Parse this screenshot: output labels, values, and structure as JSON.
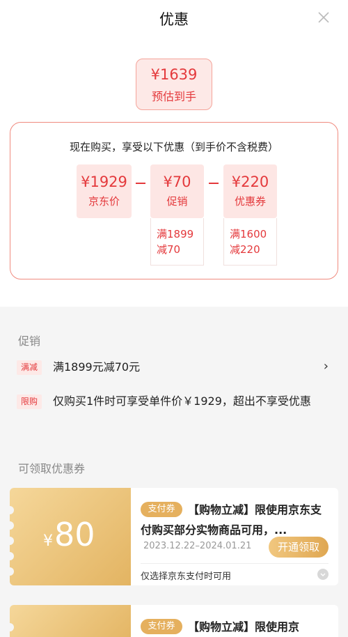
{
  "header": {
    "title": "优惠",
    "close_icon": "close-icon"
  },
  "summary": {
    "final_price": "¥1639",
    "final_label": "预估到手"
  },
  "calculation": {
    "note": "现在购买，享受以下优惠（到手价不含税费）",
    "items": [
      {
        "value": "¥1929",
        "label": "京东价"
      },
      {
        "value": "¥70",
        "label": "促销",
        "condition_line1": "满1899",
        "condition_line2": "减70"
      },
      {
        "value": "¥220",
        "label": "优惠券",
        "condition_line1": "满1600",
        "condition_line2": "减220"
      }
    ],
    "operator": "−"
  },
  "promotions": {
    "title": "促销",
    "items": [
      {
        "tag": "满减",
        "text": "满1899元减70元",
        "chevron": "›"
      },
      {
        "tag": "限购",
        "text": "仅购买1件时可享受单件价￥1929，超出不享受优惠"
      }
    ]
  },
  "coupons": {
    "title": "可领取优惠券",
    "items": [
      {
        "currency": "¥",
        "amount": "80",
        "type_tag": "支付券",
        "description": "【购物立减】限使用京东支付购买部分实物商品可用，...",
        "date": "2023.12.22–2024.01.21",
        "button": "开通领取",
        "footnote": "仅选择京东支付时可用"
      },
      {
        "type_tag": "支付券",
        "description": "【购物立减】限使用京"
      }
    ]
  },
  "colors": {
    "accent": "#e4393c",
    "gold": "#e3b462",
    "light_red": "#fde6e4"
  }
}
